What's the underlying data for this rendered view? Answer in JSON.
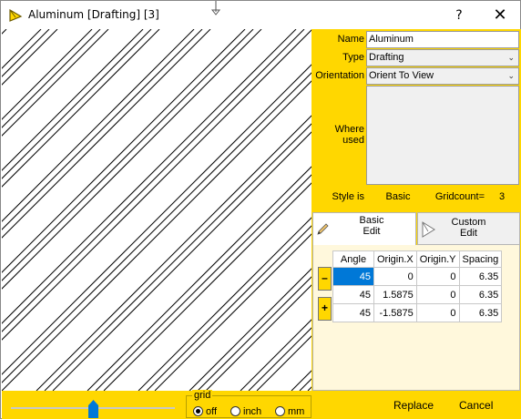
{
  "window": {
    "title": "Aluminum [Drafting] [3]",
    "help_label": "?",
    "close_label": "✕"
  },
  "properties": {
    "name_label": "Name",
    "name_value": "Aluminum",
    "type_label": "Type",
    "type_value": "Drafting",
    "orientation_label": "Orientation",
    "orientation_value": "Orient To View",
    "where_used_label_1": "Where",
    "where_used_label_2": "used",
    "style_label": "Style is",
    "style_value": "Basic",
    "gridcount_label": "Gridcount=",
    "gridcount_value": "3"
  },
  "tabs": [
    {
      "line1": "Basic",
      "line2": "Edit",
      "icon": "pencil-icon"
    },
    {
      "line1": "Custom",
      "line2": "Edit",
      "icon": "custom-cursor-icon"
    }
  ],
  "hatch_table": {
    "columns": [
      "Angle",
      "Origin.X",
      "Origin.Y",
      "Spacing"
    ],
    "rows": [
      [
        "45",
        "0",
        "0",
        "6.35"
      ],
      [
        "45",
        "1.5875",
        "0",
        "6.35"
      ],
      [
        "45",
        "-1.5875",
        "0",
        "6.35"
      ]
    ],
    "remove_label": "–",
    "add_label": "+"
  },
  "bottom": {
    "slider_level": 0.5,
    "grid_legend": "grid",
    "grid_options": [
      "off",
      "inch",
      "mm"
    ],
    "grid_selected": "off",
    "replace_label": "Replace",
    "cancel_label": "Cancel"
  },
  "colors": {
    "panel_yellow": "#FFD700",
    "pane_cream": "#FFF8DC",
    "selection_blue": "#0078D7"
  },
  "hatch_preview": {
    "angle_deg": 45,
    "pattern": "three parallel lines per spacing"
  }
}
